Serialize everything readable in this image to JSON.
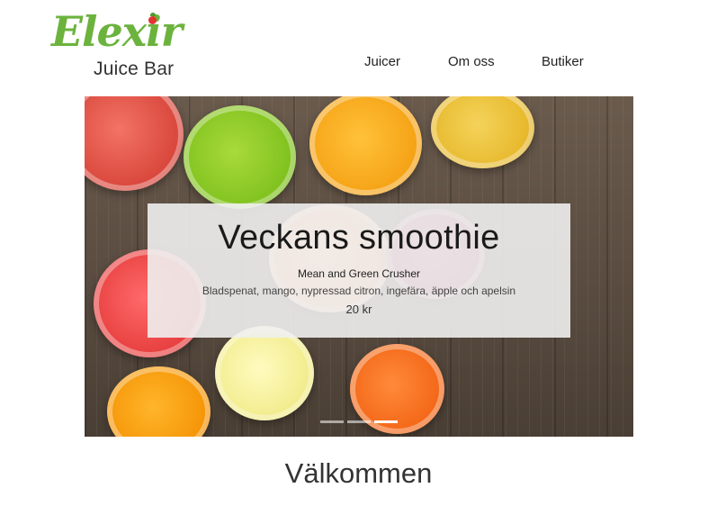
{
  "logo": {
    "script_text": "Elexir",
    "sub_text": "Juice Bar",
    "brand_color": "#6cb33e",
    "accent_color": "#e3342f"
  },
  "nav": {
    "items": [
      {
        "label": "Juicer"
      },
      {
        "label": "Om oss"
      },
      {
        "label": "Butiker"
      }
    ]
  },
  "carousel": {
    "caption": {
      "title": "Veckans smoothie",
      "name": "Mean and Green Crusher",
      "description": "Bladspenat, mango, nypressad citron, ingefära, äpple och apelsin",
      "price": "20 kr"
    },
    "slide_count": 3,
    "active_slide": 3
  },
  "main": {
    "welcome_heading": "Välkommen"
  }
}
